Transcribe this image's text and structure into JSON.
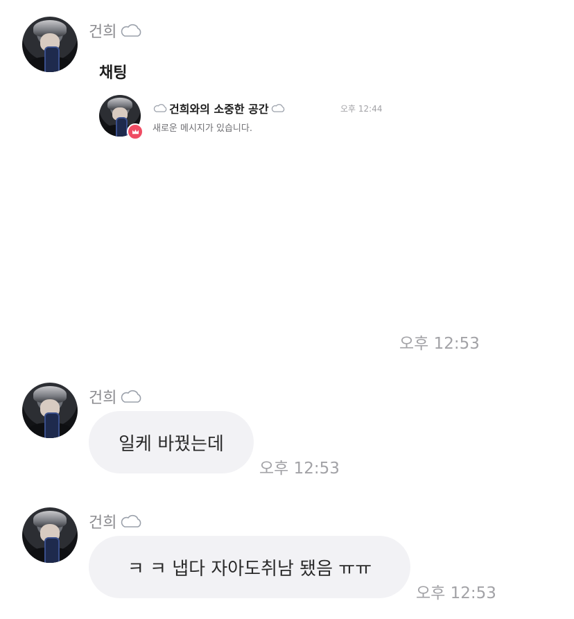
{
  "messages": [
    {
      "sender": "건희",
      "type": "shared_chat",
      "share": {
        "title": "채팅",
        "room_name": "건희와의 소중한 공간",
        "preview": "새로운 메시지가 있습니다.",
        "time": "오후 12:44"
      }
    },
    {
      "type": "time_only",
      "time": "오후 12:53"
    },
    {
      "sender": "건희",
      "type": "text",
      "text": "일케 바꿨는데",
      "time": "오후 12:53"
    },
    {
      "sender": "건희",
      "type": "text",
      "text": "ㅋ ㅋ 냅다 자아도취남 됐음 ㅠㅠ",
      "time": "오후 12:53"
    }
  ],
  "icons": {
    "sender_suffix": "cloud-icon",
    "room_badge": "crown-icon"
  },
  "colors": {
    "bubble": "#f2f2f5",
    "badge": "#ef4c63",
    "meta_text": "#a2a2a6"
  }
}
